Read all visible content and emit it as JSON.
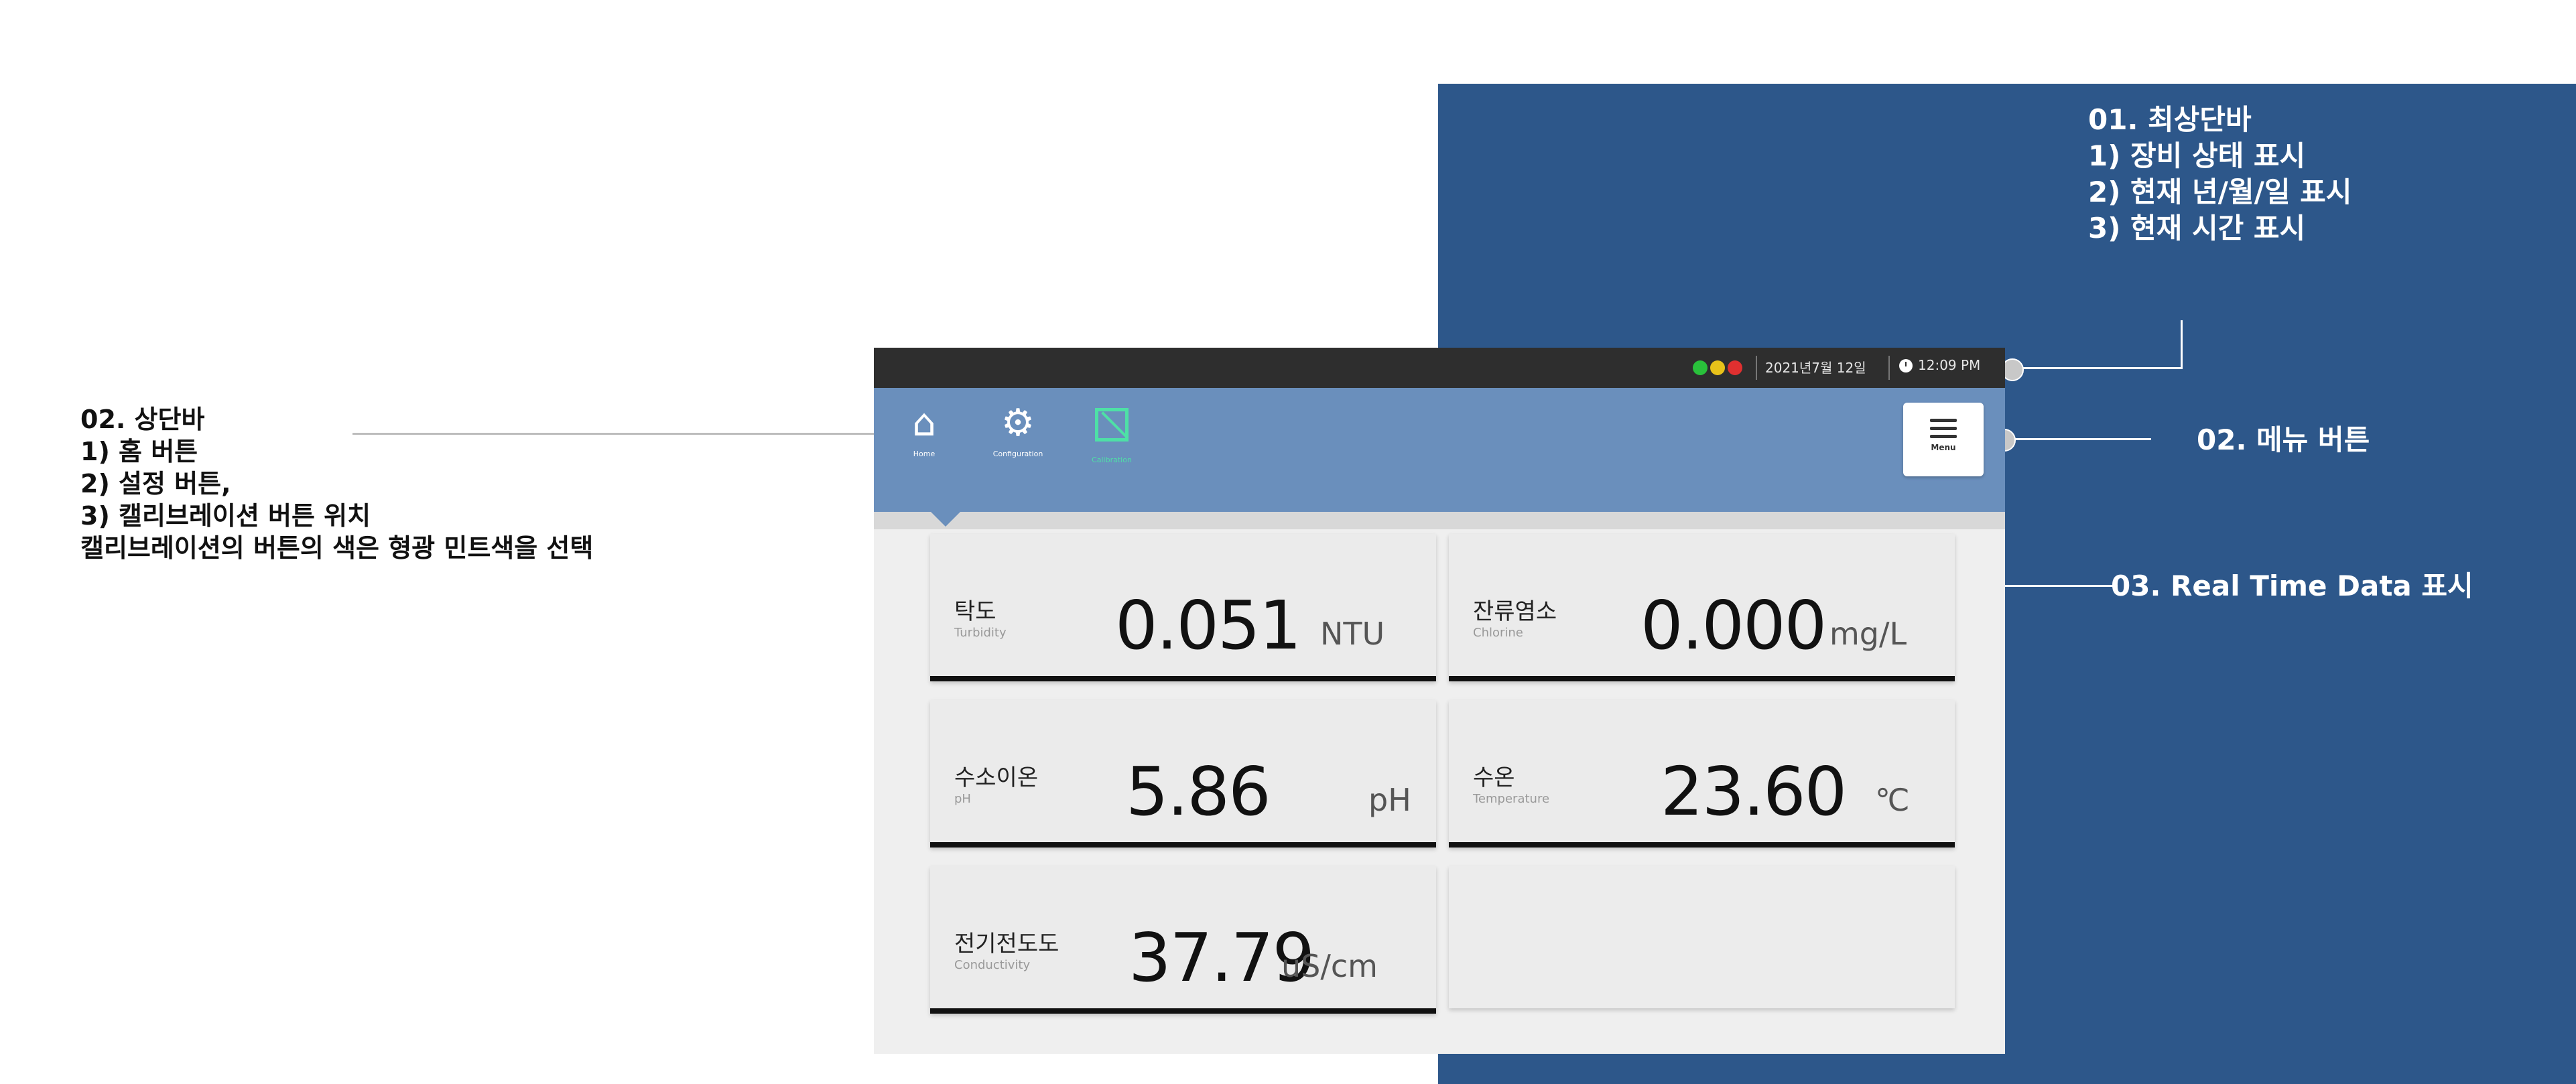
{
  "annotations": {
    "top_bar": {
      "title": "01. 최상단바",
      "items": [
        "1) 장비 상태 표시",
        "2) 현재 년/월/일 표시",
        "3) 현재 시간 표시"
      ]
    },
    "nav_bar": {
      "title": "02. 상단바",
      "items": [
        "1) 홈 버튼",
        "2) 설정 버튼,",
        "3) 캘리브레이션 버튼 위치",
        "캘리브레이션의 버튼의 색은 형광 민트색을 선택"
      ]
    },
    "menu_button": "02. 메뉴 버튼",
    "real_time_data": "03. Real Time Data 표시"
  },
  "status_bar": {
    "lamps": [
      "#29c13b",
      "#e8c21a",
      "#e03030"
    ],
    "date": "2021년7월 12일",
    "time": "12:09 PM"
  },
  "nav": {
    "buttons": [
      {
        "label": "Home",
        "icon": "home-icon"
      },
      {
        "label": "Configuration",
        "icon": "gear-icon"
      },
      {
        "label": "Calibration",
        "icon": "calibration-icon"
      }
    ],
    "menu_label": "Menu",
    "calibration_color": "#4ee0a6"
  },
  "cards": [
    {
      "name_ko": "탁도",
      "name_en": "Turbidity",
      "value": "0.051",
      "unit": "NTU"
    },
    {
      "name_ko": "잔류염소",
      "name_en": "Chlorine",
      "value": "0.000",
      "unit": "mg/L"
    },
    {
      "name_ko": "수소이온",
      "name_en": "pH",
      "value": "5.86",
      "unit": "pH"
    },
    {
      "name_ko": "수온",
      "name_en": "Temperature",
      "value": "23.60",
      "unit": "℃"
    },
    {
      "name_ko": "전기전도도",
      "name_en": "Conductivity",
      "value": "37.79",
      "unit": "uS/cm"
    }
  ],
  "colors": {
    "background_panel": "#2d578a",
    "nav_bar": "#6a8fbc",
    "status_bar": "#2e2e2e"
  }
}
